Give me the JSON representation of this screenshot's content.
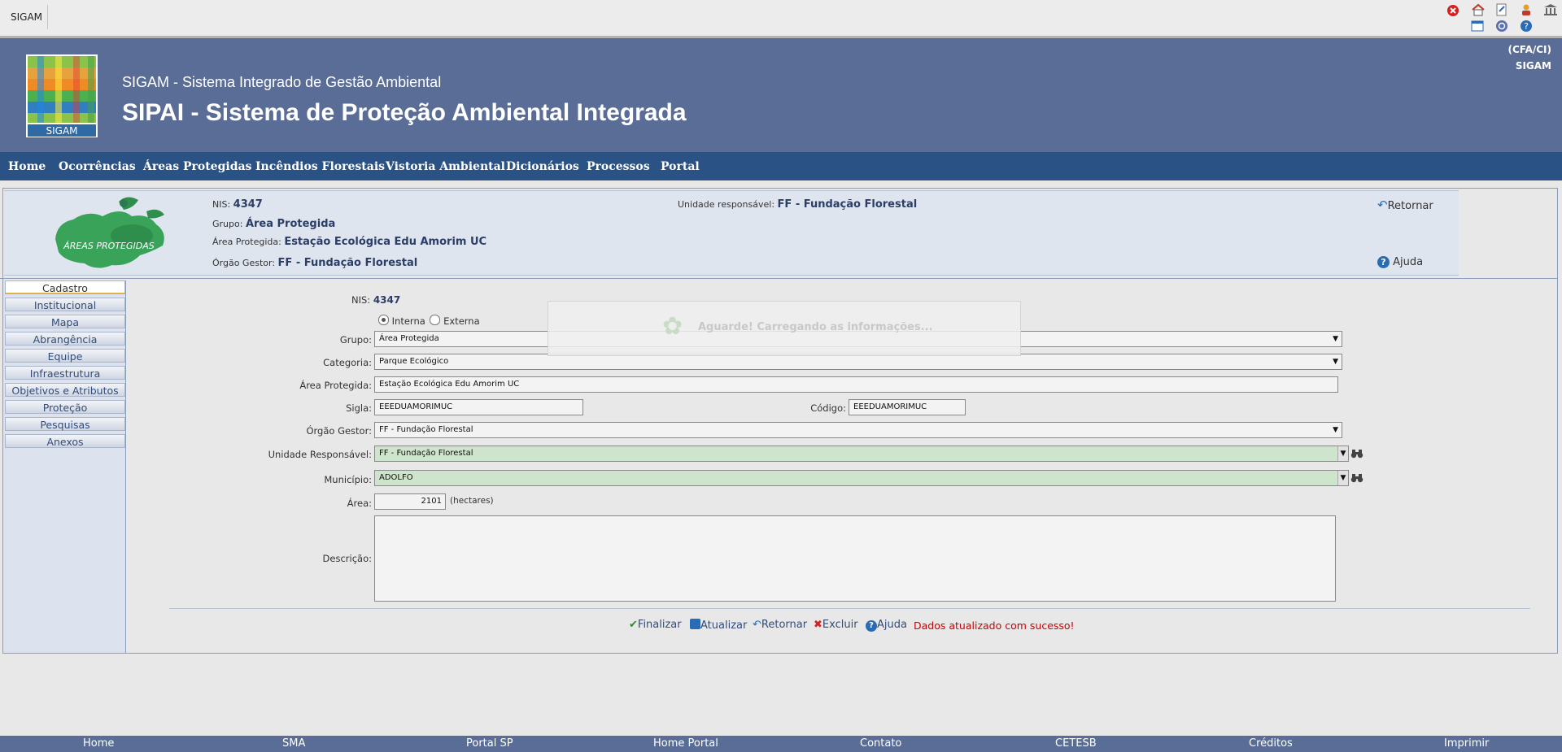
{
  "topbar": {
    "app": "SIGAM",
    "icons": [
      "close-icon",
      "home-icon",
      "page-edit-icon",
      "user-icon",
      "institution-icon",
      "calendar-icon",
      "refresh-icon",
      "help-icon"
    ]
  },
  "header": {
    "logo_text": "SIGAM",
    "system_name": "SIGAM - Sistema Integrado de Gestão Ambiental",
    "app_title": "SIPAI - Sistema de Proteção Ambiental Integrada",
    "user_unit": "(CFA/CI)",
    "user_system": "SIGAM"
  },
  "nav": [
    "Home",
    "Ocorrências",
    "Áreas Protegidas",
    "Incêndios Florestais",
    "Vistoria Ambiental",
    "Dicionários",
    "Processos",
    "Portal"
  ],
  "info": {
    "emblem_text": "ÁREAS PROTEGIDAS",
    "nis_label": "NIS:",
    "nis_value": "4347",
    "grupo_label": "Grupo:",
    "grupo_value": "Área Protegida",
    "area_label": "Área Protegida:",
    "area_value": "Estação Ecológica Edu Amorim UC",
    "orgao_label": "Órgão Gestor:",
    "orgao_value": "FF - Fundação Florestal",
    "unidade_label": "Unidade responsável:",
    "unidade_value": "FF - Fundação Florestal",
    "retornar": "Retornar",
    "ajuda": "Ajuda"
  },
  "tabs": [
    "Cadastro",
    "Institucional",
    "Mapa",
    "Abrangência",
    "Equipe",
    "Infraestrutura",
    "Objetivos e Atributos",
    "Proteção",
    "Pesquisas",
    "Anexos"
  ],
  "form": {
    "nis_label": "NIS:",
    "nis_value": "4347",
    "radio_interna": "Interna",
    "radio_externa": "Externa",
    "radio_selected": "Interna",
    "grupo_label": "Grupo:",
    "grupo_value": "Área Protegida",
    "categoria_label": "Categoria:",
    "categoria_value": "Parque Ecológico",
    "area_label": "Área Protegida:",
    "area_value": "Estação Ecológica Edu Amorim UC",
    "sigla_label": "Sigla:",
    "sigla_value": "EEEDUAMORIMUC",
    "codigo_label": "Código:",
    "codigo_value": "EEEDUAMORIMUC",
    "orgao_label": "Órgão Gestor:",
    "orgao_value": "FF - Fundação Florestal",
    "unidade_label": "Unidade Responsável:",
    "unidade_value": "FF - Fundação Florestal",
    "municipio_label": "Município:",
    "municipio_value": "ADOLFO",
    "area_ha_label": "Área:",
    "area_ha_value": "2101",
    "area_ha_unit": "(hectares)",
    "descricao_label": "Descrição:",
    "descricao_value": ""
  },
  "loading": "Aguarde! Carregando as informações...",
  "actions": {
    "finalizar": "Finalizar",
    "atualizar": "Atualizar",
    "retornar": "Retornar",
    "excluir": "Excluir",
    "ajuda": "Ajuda",
    "message": "Dados atualizado com sucesso!"
  },
  "footer": [
    "Home",
    "SMA",
    "Portal SP",
    "Home Portal",
    "Contato",
    "CETESB",
    "Créditos",
    "Imprimir"
  ],
  "colors": {
    "header": "#5a6d96",
    "nav": "#2b5285",
    "message": "#cc0000",
    "green_field": "#cfe4cc"
  }
}
